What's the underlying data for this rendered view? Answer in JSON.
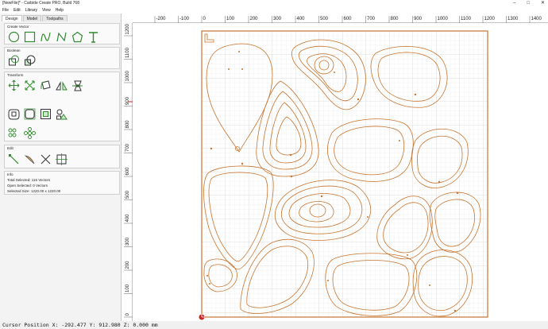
{
  "window": {
    "title": "[NewFile]* - Carbide Create PRO, Build 768",
    "minimize": "–",
    "maximize": "□",
    "close": "✕"
  },
  "menu": [
    "File",
    "Edit",
    "Library",
    "View",
    "Help"
  ],
  "tabs": [
    "Design",
    "Model",
    "Toolpaths"
  ],
  "sections": {
    "create_vector": "Create Vector",
    "boolean": "Boolean",
    "transform": "Transform",
    "edit": "Edit",
    "info": "Info"
  },
  "info": {
    "total_selected": "Total Selected: 116 Vectors",
    "open_selected": "Open Selected:  0 Vectors",
    "selected_size": "Selected Size:   1220.00 x 1220.00"
  },
  "ruler": {
    "x_ticks": [
      "-200",
      "-100",
      "0",
      "100",
      "200",
      "300",
      "400",
      "500",
      "600",
      "700",
      "800",
      "900",
      "1000",
      "1100",
      "1200",
      "1300",
      "1400"
    ],
    "y_ticks": [
      "1200",
      "1100",
      "1000",
      "900",
      "800",
      "700",
      "600",
      "500",
      "400",
      "300",
      "200",
      "100",
      "0"
    ]
  },
  "status": {
    "cursor": "Cursor Position X: -292.477 Y: 912.980 Z: 0.000 mm"
  },
  "colors": {
    "accent": "#2e8b2e",
    "vector": "#c8742e",
    "grid": "#e3e3e3",
    "origin": "#cc2222"
  }
}
